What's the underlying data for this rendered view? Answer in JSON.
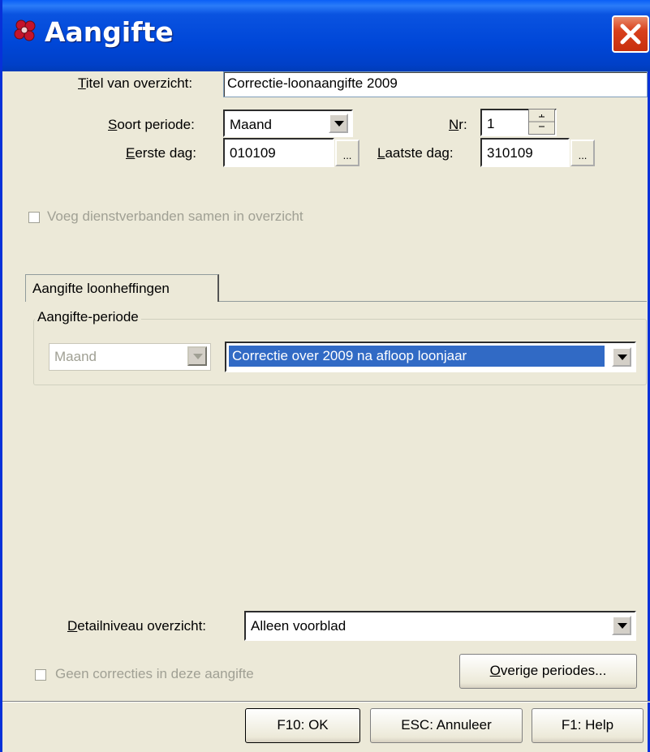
{
  "window": {
    "title": "Aangifte",
    "icon": "app-flower-icon",
    "close_icon": "close-icon"
  },
  "form": {
    "titel_label": "Titel van overzicht:",
    "titel_value": "Correctie-loonaangifte 2009",
    "soort_label": "Soort periode:",
    "soort_value": "Maand",
    "nr_label": "Nr:",
    "nr_value": "1",
    "eerste_label": "Eerste dag:",
    "eerste_value": "010109",
    "laatste_label": "Laatste dag:",
    "laatste_value": "310109",
    "browse_label": "...",
    "voeg_label": "Voeg dienstverbanden samen in overzicht"
  },
  "tab": {
    "label": "Aangifte loonheffingen",
    "group_title": "Aangifte-periode",
    "period_value": "Maand",
    "correction_value": "Correctie over 2009 na afloop loonjaar"
  },
  "detail": {
    "label": "Detailniveau overzicht:",
    "value": "Alleen voorblad"
  },
  "geen_label": "Geen correcties in deze aangifte",
  "overige_label": "Overige periodes...",
  "buttons": {
    "ok": "F10: OK",
    "cancel": "ESC: Annuleer",
    "help": "F1: Help"
  },
  "colors": {
    "titlebar": "#0047d8",
    "selection": "#316ac5",
    "close": "#d8401c",
    "window_bg": "#ece9d8"
  }
}
